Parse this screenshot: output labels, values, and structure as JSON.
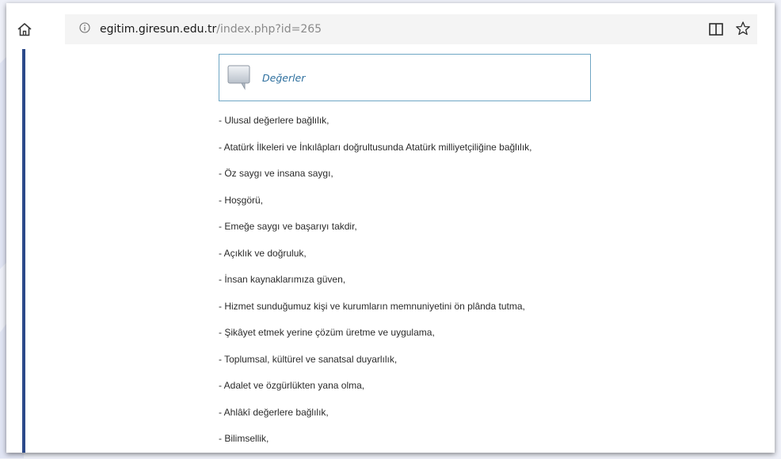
{
  "browser": {
    "url_host": "egitim.giresun.edu.tr",
    "url_path": "/index.php?id=265",
    "icons": {
      "home": "home-icon",
      "info": "info-icon",
      "reader": "reader-view-icon",
      "bookmark": "star-icon"
    }
  },
  "page": {
    "heading": "Değerler",
    "heading_color": "#2d6f9e",
    "accent_bar_color": "#2c4a8a",
    "items": [
      "- Ulusal değerlere bağlılık,",
      "- Atatürk İlkeleri ve İnkılâpları doğrultusunda Atatürk milliyetçiliğine bağlılık,",
      "- Öz saygı ve insana saygı,",
      "- Hoşgörü,",
      "- Emeğe saygı ve başarıyı takdir,",
      "- Açıklık ve doğruluk,",
      "- İnsan kaynaklarımıza güven,",
      "- Hizmet sunduğumuz kişi ve kurumların memnuniyetini ön plânda tutma,",
      "- Şikâyet etmek yerine çözüm üretme ve uygulama,",
      "- Toplumsal, kültürel ve sanatsal duyarlılık,",
      "- Adalet ve özgürlükten yana olma,",
      "- Ahlâkî değerlere bağlılık,",
      "- Bilimsellik,"
    ]
  }
}
